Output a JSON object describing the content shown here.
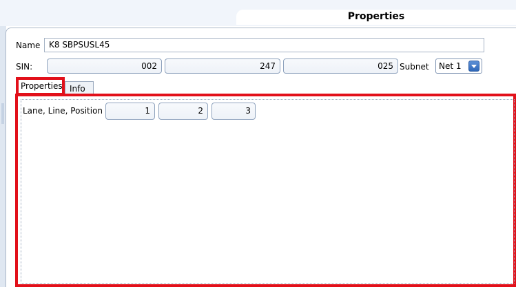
{
  "window": {
    "title": "Properties"
  },
  "form": {
    "name_label": "Name",
    "name_value": "K8 SBPSUSL45",
    "sin_label": "SIN:",
    "sin_values": [
      "002",
      "247",
      "025"
    ],
    "subnet_label": "Subnet",
    "subnet_value": "Net 1"
  },
  "tabs": {
    "properties": "Properties",
    "info": "Info"
  },
  "properties_tab": {
    "position_label": "Lane, Line, Position",
    "position_values": [
      "1",
      "2",
      "3"
    ]
  },
  "highlight_color": "#e2101a"
}
